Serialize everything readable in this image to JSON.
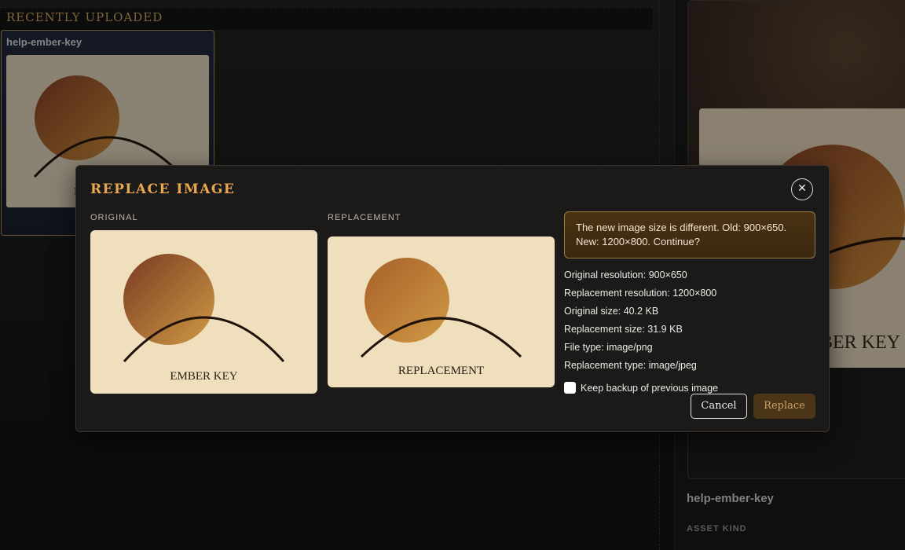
{
  "recent": {
    "section_title": "RECENTLY UPLOADED",
    "asset_card": {
      "title": "help-ember-key"
    }
  },
  "detail_panel": {
    "asset_name": "help-ember-key",
    "asset_kind_label": "ASSET KIND",
    "preview_caption_partial": "EMBER KEY"
  },
  "modal": {
    "title": "Replace Image",
    "close_icon": "close-icon",
    "original_label": "ORIGINAL",
    "replacement_label": "REPLACEMENT",
    "original_caption": "EMBER KEY",
    "replacement_caption": "REPLACEMENT",
    "warning": "The new image size is different. Old: 900×650. New: 1200×800. Continue?",
    "info": {
      "original_resolution": "Original resolution: 900×650",
      "replacement_resolution": "Replacement resolution: 1200×800",
      "original_size": "Original size: 40.2 KB",
      "replacement_size": "Replacement size: 31.9 KB",
      "file_type": "File type: image/png",
      "replacement_type": "Replacement type: image/jpeg"
    },
    "backup_checkbox": {
      "label": "Keep backup of previous image",
      "checked": false
    },
    "cancel_label": "Cancel",
    "replace_label": "Replace"
  },
  "colors": {
    "accent": "#e8a850",
    "warning_bg": "#4a3214",
    "image_bg": "#efdfbd"
  }
}
